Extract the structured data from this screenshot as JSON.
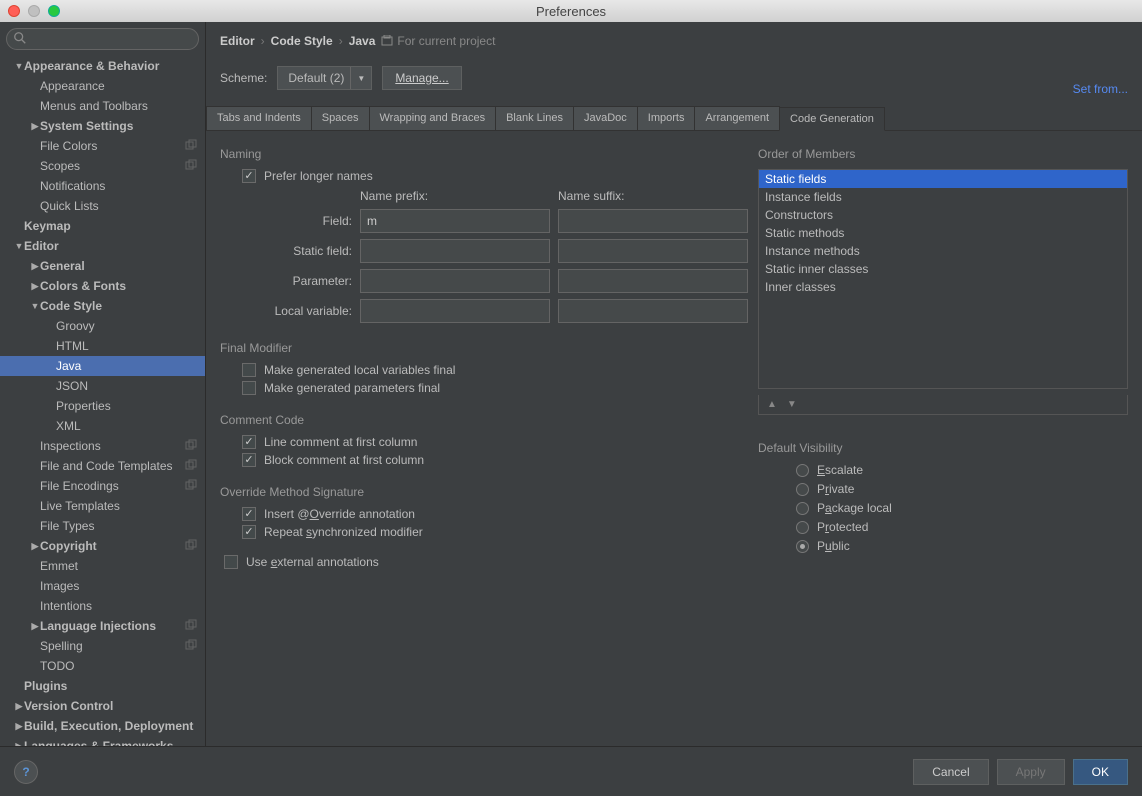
{
  "window": {
    "title": "Preferences"
  },
  "sidebar": {
    "search_placeholder": "",
    "items": [
      {
        "label": "Appearance & Behavior",
        "indent": 0,
        "bold": true,
        "arrow": "▼"
      },
      {
        "label": "Appearance",
        "indent": 1
      },
      {
        "label": "Menus and Toolbars",
        "indent": 1
      },
      {
        "label": "System Settings",
        "indent": 1,
        "bold": true,
        "arrow": "▶"
      },
      {
        "label": "File Colors",
        "indent": 1,
        "share": true
      },
      {
        "label": "Scopes",
        "indent": 1,
        "share": true
      },
      {
        "label": "Notifications",
        "indent": 1
      },
      {
        "label": "Quick Lists",
        "indent": 1
      },
      {
        "label": "Keymap",
        "indent": 0,
        "bold": true
      },
      {
        "label": "Editor",
        "indent": 0,
        "bold": true,
        "arrow": "▼"
      },
      {
        "label": "General",
        "indent": 1,
        "bold": true,
        "arrow": "▶"
      },
      {
        "label": "Colors & Fonts",
        "indent": 1,
        "bold": true,
        "arrow": "▶"
      },
      {
        "label": "Code Style",
        "indent": 1,
        "bold": true,
        "arrow": "▼"
      },
      {
        "label": "Groovy",
        "indent": 2
      },
      {
        "label": "HTML",
        "indent": 2
      },
      {
        "label": "Java",
        "indent": 2,
        "selected": true
      },
      {
        "label": "JSON",
        "indent": 2
      },
      {
        "label": "Properties",
        "indent": 2
      },
      {
        "label": "XML",
        "indent": 2
      },
      {
        "label": "Inspections",
        "indent": 1,
        "share": true
      },
      {
        "label": "File and Code Templates",
        "indent": 1,
        "share": true
      },
      {
        "label": "File Encodings",
        "indent": 1,
        "share": true
      },
      {
        "label": "Live Templates",
        "indent": 1
      },
      {
        "label": "File Types",
        "indent": 1
      },
      {
        "label": "Copyright",
        "indent": 1,
        "bold": true,
        "arrow": "▶",
        "share": true
      },
      {
        "label": "Emmet",
        "indent": 1
      },
      {
        "label": "Images",
        "indent": 1
      },
      {
        "label": "Intentions",
        "indent": 1
      },
      {
        "label": "Language Injections",
        "indent": 1,
        "bold": true,
        "arrow": "▶",
        "share": true
      },
      {
        "label": "Spelling",
        "indent": 1,
        "share": true
      },
      {
        "label": "TODO",
        "indent": 1
      },
      {
        "label": "Plugins",
        "indent": 0,
        "bold": true
      },
      {
        "label": "Version Control",
        "indent": 0,
        "bold": true,
        "arrow": "▶"
      },
      {
        "label": "Build, Execution, Deployment",
        "indent": 0,
        "bold": true,
        "arrow": "▶"
      },
      {
        "label": "Languages & Frameworks",
        "indent": 0,
        "bold": true,
        "arrow": "▶"
      }
    ]
  },
  "breadcrumb": {
    "a": "Editor",
    "b": "Code Style",
    "c": "Java",
    "proj": "For current project"
  },
  "scheme": {
    "label": "Scheme:",
    "value": "Default (2)",
    "manage": "Manage...",
    "set_from": "Set from..."
  },
  "tabs": [
    "Tabs and Indents",
    "Spaces",
    "Wrapping and Braces",
    "Blank Lines",
    "JavaDoc",
    "Imports",
    "Arrangement",
    "Code Generation"
  ],
  "active_tab": "Code Generation",
  "naming": {
    "title": "Naming",
    "prefer": "Prefer longer names",
    "prefix_hdr": "Name prefix:",
    "suffix_hdr": "Name suffix:",
    "rows": [
      {
        "label": "Field:",
        "prefix": "m",
        "suffix": ""
      },
      {
        "label": "Static field:",
        "prefix": "",
        "suffix": ""
      },
      {
        "label": "Parameter:",
        "prefix": "",
        "suffix": ""
      },
      {
        "label": "Local variable:",
        "prefix": "",
        "suffix": ""
      }
    ]
  },
  "final": {
    "title": "Final Modifier",
    "local": "Make generated local variables final",
    "param": "Make generated parameters final"
  },
  "comment": {
    "title": "Comment Code",
    "line": "Line comment at first column",
    "block": "Block comment at first column"
  },
  "override": {
    "title": "Override Method Signature",
    "insert_pre": "Insert @",
    "insert_u": "O",
    "insert_post": "verride annotation",
    "repeat_pre": "Repeat ",
    "repeat_u": "s",
    "repeat_post": "ynchronized modifier"
  },
  "external": {
    "pre": "Use ",
    "u": "e",
    "post": "xternal annotations"
  },
  "order": {
    "title": "Order of Members",
    "items": [
      "Static fields",
      "Instance fields",
      "Constructors",
      "Static methods",
      "Instance methods",
      "Static inner classes",
      "Inner classes"
    ],
    "selected": "Static fields"
  },
  "visibility": {
    "title": "Default Visibility",
    "options_pre": [
      "",
      "P",
      "P",
      "P",
      "P"
    ],
    "options_u": [
      "E",
      "r",
      "a",
      "r",
      "u"
    ],
    "options_post": [
      "scalate",
      "ivate",
      "ckage local",
      "otected",
      "blic"
    ],
    "selected": 4
  },
  "footer": {
    "cancel": "Cancel",
    "apply": "Apply",
    "ok": "OK"
  }
}
